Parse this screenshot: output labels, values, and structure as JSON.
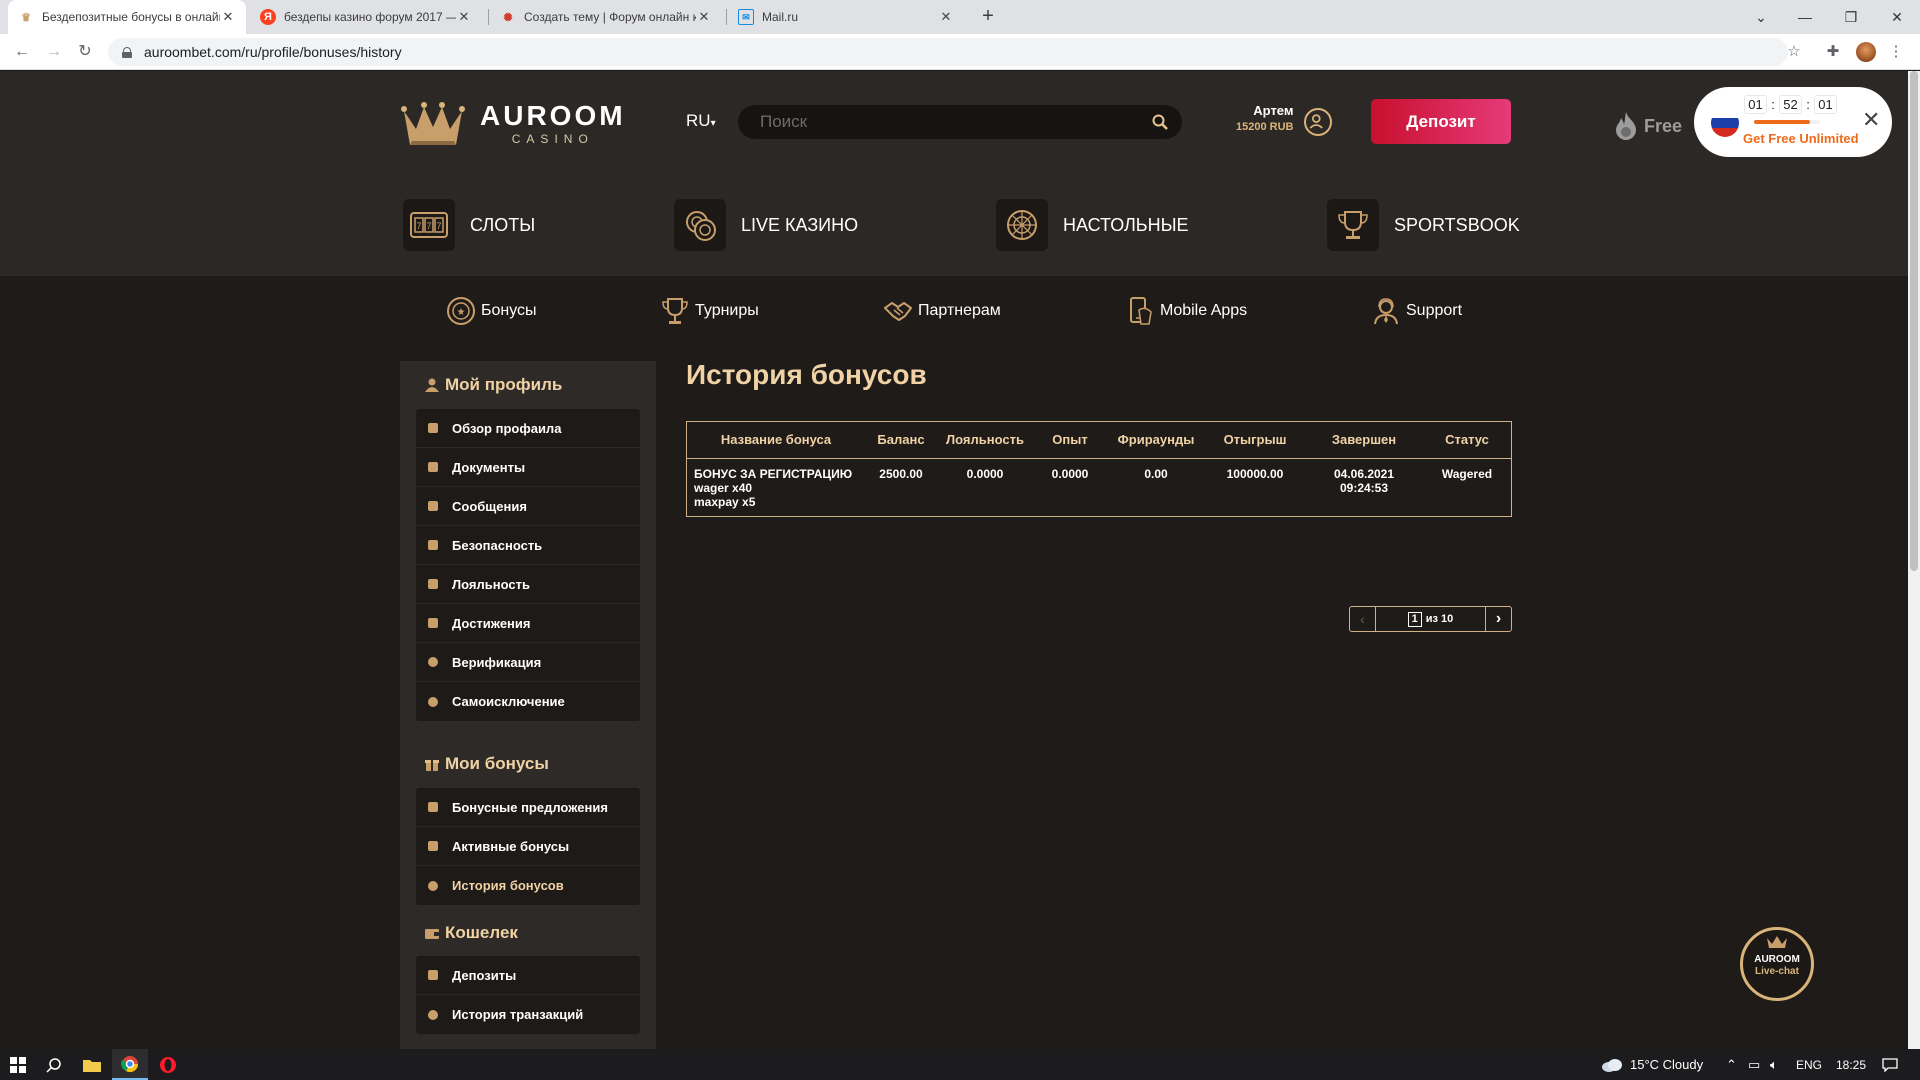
{
  "browser": {
    "tabs": [
      {
        "title": "Бездепозитные бонусы в онлайн",
        "active": true
      },
      {
        "title": "бездепы казино форум 2017 —",
        "active": false
      },
      {
        "title": "Создать тему | Форум онлайн к",
        "active": false
      },
      {
        "title": "Mail.ru",
        "active": false
      }
    ],
    "url": "auroombet.com/ru/profile/bonuses/history"
  },
  "header": {
    "logo_main": "AUROOM",
    "logo_sub": "CASINO",
    "language": "RU",
    "search_placeholder": "Поиск",
    "user_name": "Артем",
    "user_balance": "15200 RUB",
    "deposit_label": "Депозит",
    "free_label": "Free",
    "promo": {
      "timer": [
        "01",
        "52",
        "01"
      ],
      "timer_progress": 0.85,
      "text": "Get Free Unlimited"
    }
  },
  "categories": [
    {
      "label": "СЛОТЫ",
      "icon": "slot-machine-icon"
    },
    {
      "label": "LIVE КАЗИНО",
      "icon": "chips-icon"
    },
    {
      "label": "НАСТОЛЬНЫЕ",
      "icon": "roulette-icon"
    },
    {
      "label": "SPORTSBOOK",
      "icon": "trophy-icon"
    }
  ],
  "subnav": [
    {
      "label": "Бонусы",
      "icon": "bonus-coin-icon"
    },
    {
      "label": "Турниры",
      "icon": "cup-icon"
    },
    {
      "label": "Партнерам",
      "icon": "handshake-icon"
    },
    {
      "label": "Mobile Apps",
      "icon": "phone-icon"
    },
    {
      "label": "Support",
      "icon": "support-agent-icon"
    }
  ],
  "sidebar": {
    "profile_title": "Мой профиль",
    "profile_items": [
      "Обзор профаила",
      "Документы",
      "Сообщения",
      "Безопасность",
      "Лояльность",
      "Достижения",
      "Верификация",
      "Самоисключение"
    ],
    "bonuses_title": "Мои бонусы",
    "bonus_items": [
      "Бонусные предложения",
      "Активные бонусы",
      "История бонусов"
    ],
    "wallet_title": "Кошелек",
    "wallet_items": [
      "Депозиты",
      "История транзакций"
    ]
  },
  "page": {
    "title": "История бонусов"
  },
  "table": {
    "columns": [
      "Название бонуса",
      "Баланс",
      "Лояльность",
      "Опыт",
      "Фрираунды",
      "Отыгрыш",
      "Завершен",
      "Статус"
    ],
    "rows": [
      {
        "name_lines": [
          "БОНУС ЗА РЕГИСТРАЦИЮ",
          "wager x40",
          "maxpay x5"
        ],
        "balance": "2500.00",
        "loyalty": "0.0000",
        "experience": "0.0000",
        "freerounds": "0.00",
        "wager": "100000.00",
        "completed": "04.06.2021 09:24:53",
        "status": "Wagered"
      }
    ]
  },
  "pagination": {
    "current": "1",
    "of_text": "из 10"
  },
  "livechat": {
    "name": "AUROOM",
    "label": "Live-chat"
  },
  "taskbar": {
    "weather": "15°C  Cloudy",
    "lang": "ENG",
    "time": "18:25"
  },
  "colors": {
    "accent_gold": "#f0d2a5",
    "deposit_gradient_start": "#c8102e",
    "deposit_gradient_end": "#e63a7a",
    "promo_orange": "#ee6a1c"
  }
}
